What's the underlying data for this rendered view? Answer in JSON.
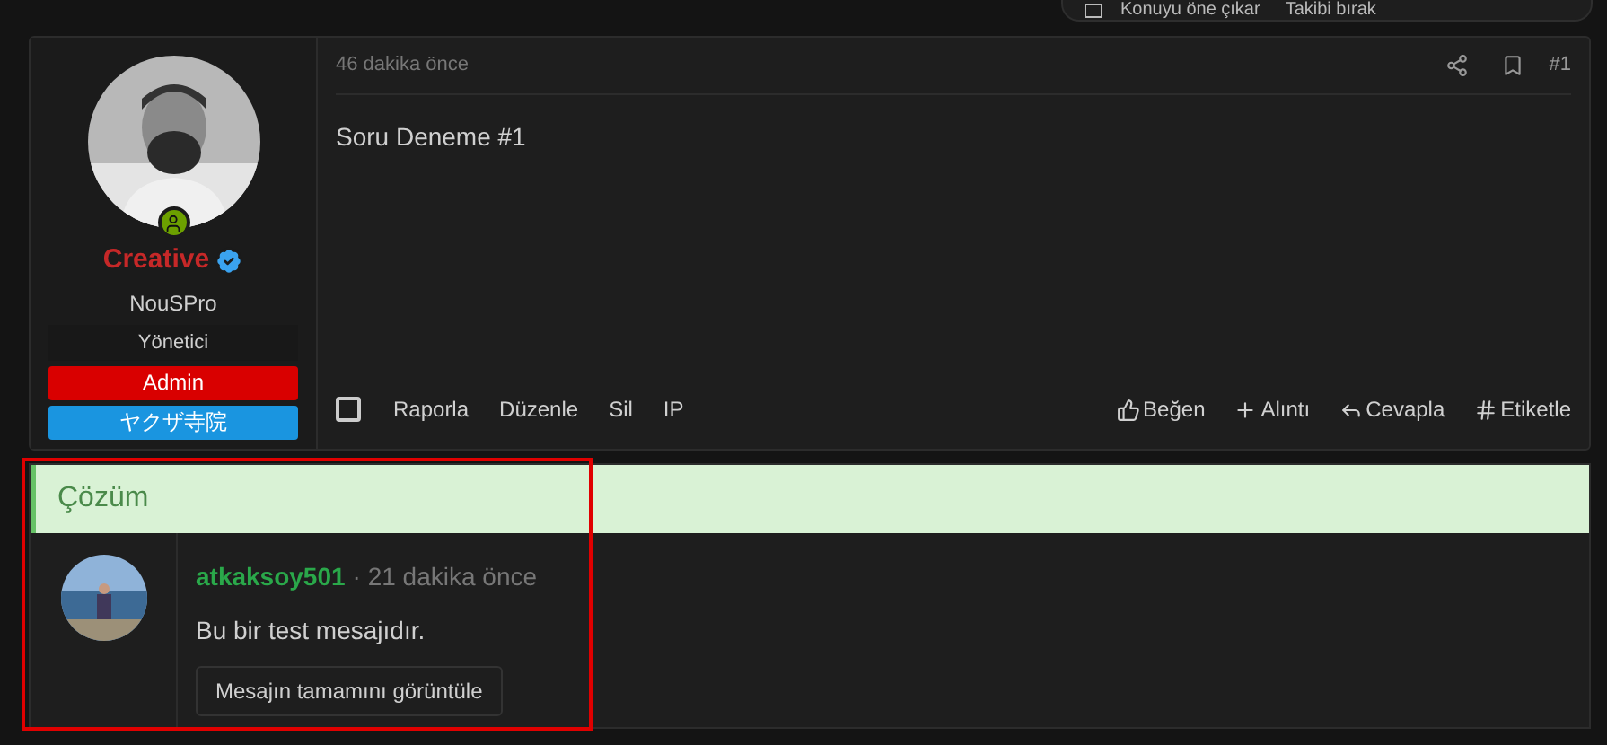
{
  "menu": {
    "items": [
      {
        "label": "Konuyu öne çıkar",
        "checked": false
      },
      {
        "label": "Takibi bırak"
      }
    ]
  },
  "post": {
    "author": {
      "name": "Creative",
      "verified": true,
      "online": true,
      "username": "NouSPro",
      "title": "Yönetici",
      "badges": [
        {
          "label": "Admin",
          "color": "#d90000"
        },
        {
          "label": "ヤクザ寺院",
          "color": "#1a95e0"
        }
      ]
    },
    "time": "46 dakika önce",
    "number": "#1",
    "body": "Soru Deneme #1",
    "selected": false,
    "actions_left": [
      "Raporla",
      "Düzenle",
      "Sil",
      "IP"
    ],
    "actions_right": [
      {
        "kind": "like",
        "label": "Beğen"
      },
      {
        "kind": "quote",
        "label": "Alıntı"
      },
      {
        "kind": "reply",
        "label": "Cevapla"
      },
      {
        "kind": "tag",
        "label": "Etiketle"
      }
    ]
  },
  "solution": {
    "title": "Çözüm",
    "highlighted": true,
    "author": "atkaksoy501",
    "time": "· 21 dakika önce",
    "body": "Bu bir test mesajıdır.",
    "button": "Mesajın tamamını görüntüle"
  }
}
